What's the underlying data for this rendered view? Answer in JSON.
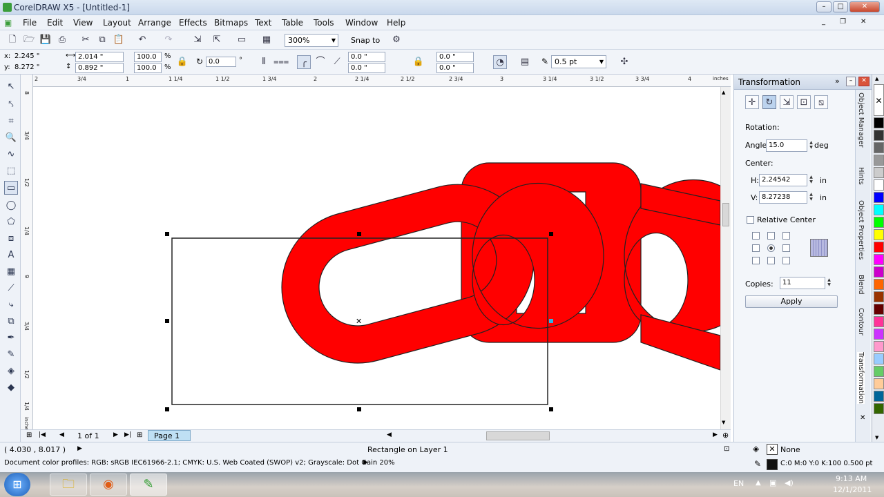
{
  "window": {
    "title": "CorelDRAW X5 - [Untitled-1]",
    "min": "–",
    "max": "□",
    "close": "✕"
  },
  "menu": [
    "File",
    "Edit",
    "View",
    "Layout",
    "Arrange",
    "Effects",
    "Bitmaps",
    "Text",
    "Table",
    "Tools",
    "Window",
    "Help"
  ],
  "toolbar": {
    "zoom": "300%",
    "snap_to": "Snap to"
  },
  "propbar": {
    "x_label": "x:",
    "x_value": "2.245 \"",
    "y_label": "y:",
    "y_value": "8.272 \"",
    "w_value": "2.014 \"",
    "h_value": "0.892 \"",
    "scale_x": "100.0",
    "scale_y": "100.0",
    "pct": "%",
    "rotation": "0.0",
    "deg": "°",
    "corner1": "0.0 \"",
    "corner2": "0.0 \"",
    "corner3": "0.0 \"",
    "corner4": "0.0 \"",
    "outline": "0.5 pt"
  },
  "hruler": {
    "labels": [
      "2",
      "3/4",
      "1",
      "1 1/4",
      "1 1/2",
      "1 3/4",
      "2",
      "2 1/4",
      "2 1/2",
      "2 3/4",
      "3",
      "3 1/4",
      "3 1/2",
      "3 3/4",
      "4"
    ],
    "unit": "inches"
  },
  "vruler": {
    "labels": [
      "8",
      "3/4",
      "1/2",
      "1/4",
      "9",
      "3/4",
      "1/2",
      "1/4"
    ],
    "unit": "inches"
  },
  "page": {
    "counter": "1 of 1",
    "tab": "Page 1"
  },
  "docker": {
    "title": "Transformation",
    "rotation_label": "Rotation:",
    "angle_label": "Angle:",
    "angle_value": "15.0",
    "angle_unit": "deg",
    "center_label": "Center:",
    "h_label": "H:",
    "h_value": "2.24542",
    "h_unit": "in",
    "v_label": "V:",
    "v_value": "8.27238",
    "v_unit": "in",
    "relative_center": "Relative Center",
    "copies_label": "Copies:",
    "copies_value": "11",
    "apply": "Apply",
    "tabs": [
      "Object Manager",
      "Hints",
      "Object Properties",
      "Blend",
      "Contour",
      "Transformation"
    ]
  },
  "palette": [
    "#000000",
    "#333333",
    "#666666",
    "#999999",
    "#cccccc",
    "#ffffff",
    "#0000ff",
    "#00ffff",
    "#00ff00",
    "#ffff00",
    "#ff0000",
    "#ff00ff",
    "#cc00cc",
    "#ff6600",
    "#993300",
    "#660000",
    "#ff3399",
    "#cc33ff",
    "#ff99cc",
    "#99ccff",
    "#66cc66",
    "#ffcc99",
    "#006699",
    "#336600"
  ],
  "status": {
    "coords": "( 4.030 , 8.017 )",
    "object": "Rectangle on Layer 1",
    "profiles": "Document color profiles: RGB: sRGB IEC61966-2.1; CMYK: U.S. Web Coated (SWOP) v2; Grayscale: Dot Gain 20%",
    "fill": "None",
    "outline": "C:0 M:0 Y:0 K:100  0.500 pt"
  },
  "taskbar": {
    "lang": "EN",
    "time": "9:13 AM",
    "date": "12/1/2011"
  },
  "colors": {
    "chain": "#ff0000",
    "selection": "#000000"
  }
}
